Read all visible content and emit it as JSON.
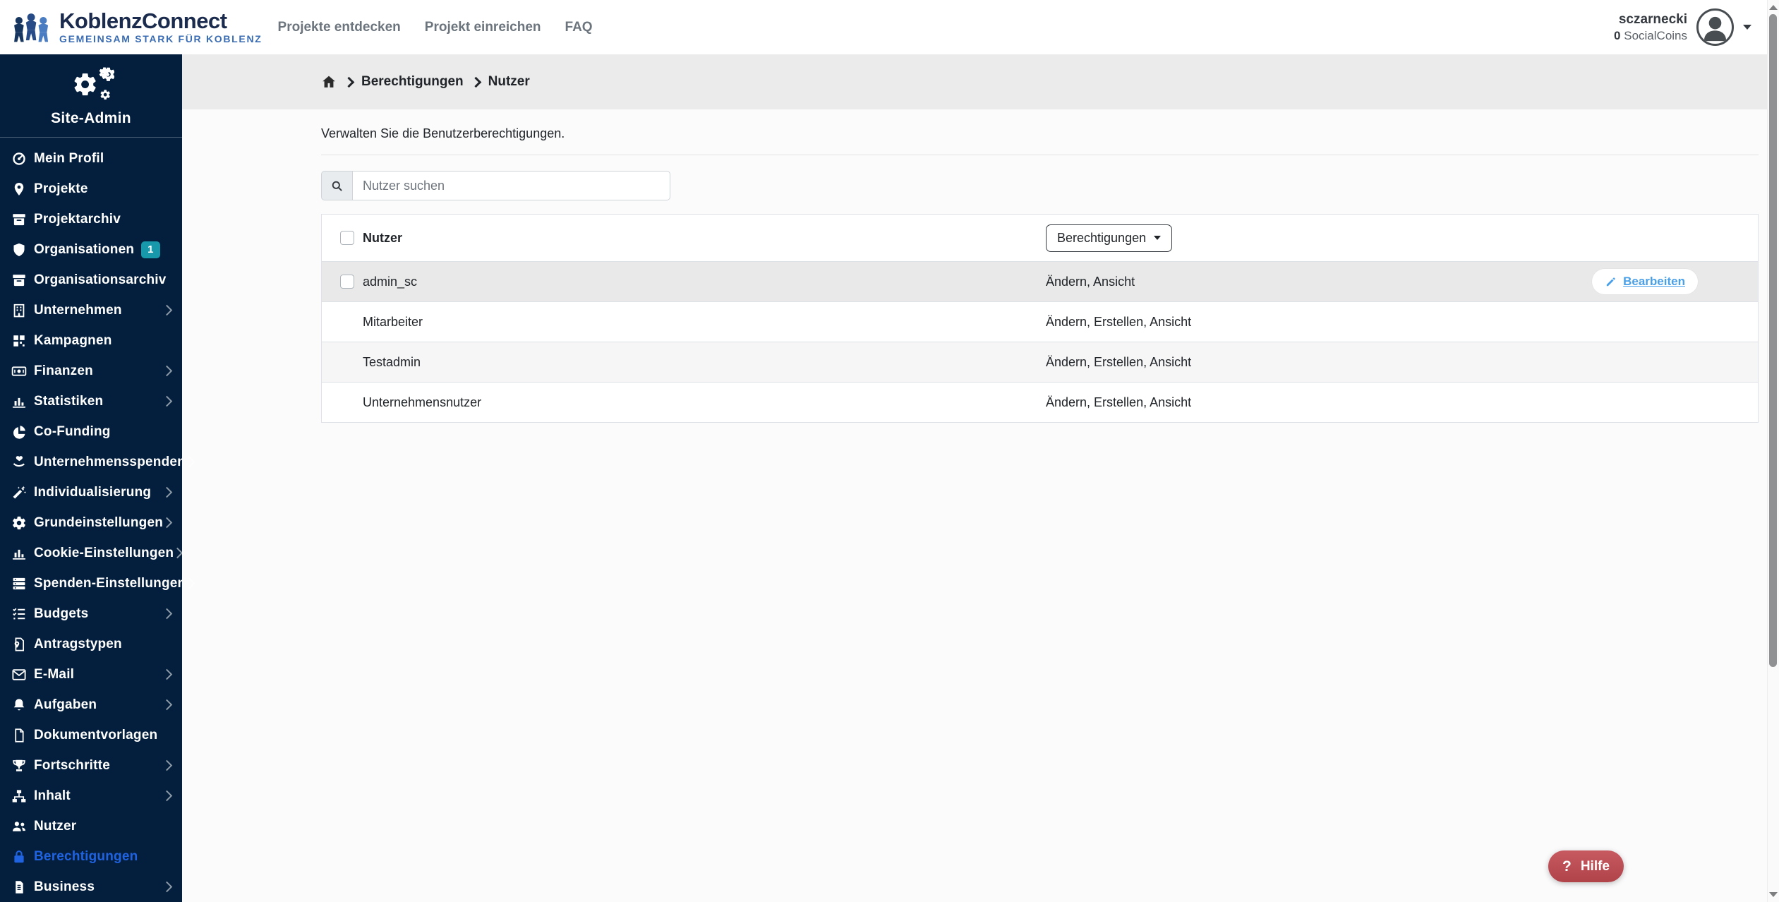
{
  "header": {
    "logo": {
      "title": "KoblenzConnect",
      "tagline": "GEMEINSAM STARK FÜR KOBLENZ"
    },
    "nav": [
      {
        "label": "Projekte entdecken"
      },
      {
        "label": "Projekt einreichen"
      },
      {
        "label": "FAQ"
      }
    ],
    "user": {
      "name": "sczarnecki",
      "coins_value": "0",
      "coins_label": "SocialCoins"
    }
  },
  "sidebar": {
    "title": "Site-Admin",
    "items": [
      {
        "label": "Mein Profil",
        "icon": "dashboard-icon"
      },
      {
        "label": "Projekte",
        "icon": "map-marker-icon"
      },
      {
        "label": "Projektarchiv",
        "icon": "archive-icon"
      },
      {
        "label": "Organisationen",
        "icon": "shield-icon",
        "badge": "1"
      },
      {
        "label": "Organisationsarchiv",
        "icon": "archive-icon"
      },
      {
        "label": "Unternehmen",
        "icon": "building-icon",
        "expandable": true
      },
      {
        "label": "Kampagnen",
        "icon": "grid-icon"
      },
      {
        "label": "Finanzen",
        "icon": "money-icon",
        "expandable": true
      },
      {
        "label": "Statistiken",
        "icon": "chart-bar-icon",
        "expandable": true
      },
      {
        "label": "Co-Funding",
        "icon": "chart-pie-icon"
      },
      {
        "label": "Unternehmensspenden",
        "icon": "hand-heart-icon",
        "expandable": true
      },
      {
        "label": "Individualisierung",
        "icon": "magic-wand-icon",
        "expandable": true
      },
      {
        "label": "Grundeinstellungen",
        "icon": "gear-icon",
        "expandable": true
      },
      {
        "label": "Cookie-Einstellungen",
        "icon": "chart-bar-icon",
        "expandable": true
      },
      {
        "label": "Spenden-Einstellungen",
        "icon": "server-icon",
        "expandable": true
      },
      {
        "label": "Budgets",
        "icon": "tasks-icon",
        "expandable": true
      },
      {
        "label": "Antragstypen",
        "icon": "file-marker-icon"
      },
      {
        "label": "E-Mail",
        "icon": "envelope-icon",
        "expandable": true
      },
      {
        "label": "Aufgaben",
        "icon": "bell-icon",
        "expandable": true
      },
      {
        "label": "Dokumentvorlagen",
        "icon": "file-icon"
      },
      {
        "label": "Fortschritte",
        "icon": "trophy-icon",
        "expandable": true
      },
      {
        "label": "Inhalt",
        "icon": "sitemap-icon",
        "expandable": true
      },
      {
        "label": "Nutzer",
        "icon": "users-icon"
      },
      {
        "label": "Berechtigungen",
        "icon": "lock-icon",
        "active": true
      },
      {
        "label": "Business",
        "icon": "file-text-icon",
        "expandable": true
      }
    ]
  },
  "breadcrumb": {
    "items": [
      "Berechtigungen",
      "Nutzer"
    ]
  },
  "main": {
    "description": "Verwalten Sie die Benutzerberechtigungen.",
    "search_placeholder": "Nutzer suchen",
    "table": {
      "name_header": "Nutzer",
      "permissions_dropdown_label": "Berechtigungen",
      "rows": [
        {
          "name": "admin_sc",
          "permissions": "Ändern, Ansicht",
          "checkbox": true,
          "selected": true,
          "action": "Bearbeiten"
        },
        {
          "name": "Mitarbeiter",
          "permissions": "Ändern, Erstellen, Ansicht"
        },
        {
          "name": "Testadmin",
          "permissions": "Ändern, Erstellen, Ansicht",
          "striped": true
        },
        {
          "name": "Unternehmensnutzer",
          "permissions": "Ändern, Erstellen, Ansicht"
        }
      ]
    }
  },
  "help_button": {
    "icon": "?",
    "label": "Hilfe"
  },
  "colors": {
    "sidebar_bg": "#041f3d",
    "active_link": "#1f63e0",
    "badge_bg": "#1798ab",
    "breadcrumb_bg": "#ebebeb",
    "selected_row_bg": "#e9e9e9",
    "edit_link": "#4aa0e8",
    "help_button_bg": "#b84b52",
    "brand_navy": "#1b2b4d",
    "brand_blue": "#3a6cb3"
  }
}
